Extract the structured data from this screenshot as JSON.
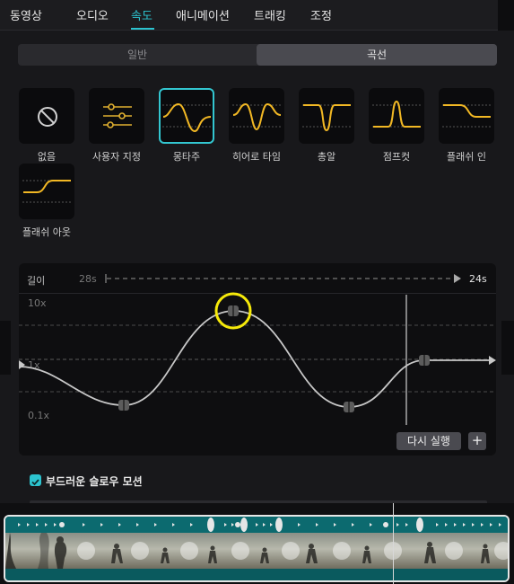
{
  "tabs": [
    {
      "label": "동영상",
      "active": false
    },
    {
      "label": "오디오",
      "active": false
    },
    {
      "label": "속도",
      "active": true
    },
    {
      "label": "애니메이션",
      "active": false
    },
    {
      "label": "트래킹",
      "active": false
    },
    {
      "label": "조정",
      "active": false
    }
  ],
  "segment": {
    "options": [
      "일반",
      "곡선"
    ],
    "selected": "곡선"
  },
  "presets": [
    {
      "label": "없음",
      "icon": "none-icon"
    },
    {
      "label": "사용자 지정",
      "icon": "custom-sliders-icon"
    },
    {
      "label": "몽타주",
      "icon": "montage-curve-icon",
      "selected": true
    },
    {
      "label": "히어로 타임",
      "icon": "hero-time-curve-icon"
    },
    {
      "label": "총알",
      "icon": "bullet-curve-icon"
    },
    {
      "label": "점프컷",
      "icon": "jump-cut-curve-icon"
    },
    {
      "label": "플래쉬 인",
      "icon": "flash-in-curve-icon"
    },
    {
      "label": "플래쉬 아웃",
      "icon": "flash-out-curve-icon"
    }
  ],
  "editor": {
    "length_label": "길이",
    "from_duration": "28s",
    "to_duration": "24s",
    "y_max": "10x",
    "y_mid": "1x",
    "y_min": "0.1x",
    "reset_label": "다시 실행",
    "add_label": "+"
  },
  "smooth_slow_motion": {
    "label": "부드러운 슬로우 모션",
    "checked": true
  },
  "colors": {
    "accent": "#2cc3cf",
    "curve_yellow": "#f2b824",
    "highlight_circle": "#f5e90a"
  }
}
